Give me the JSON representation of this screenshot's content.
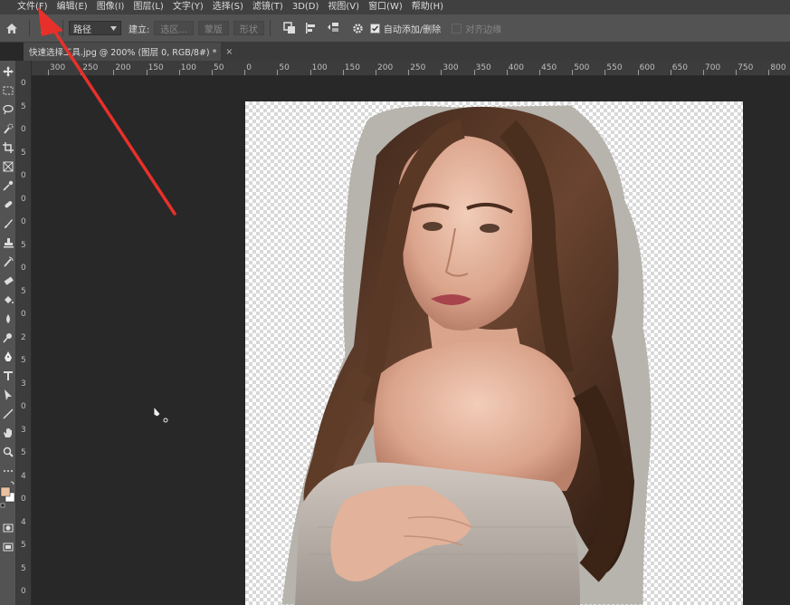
{
  "menu": {
    "items": [
      "文件(F)",
      "编辑(E)",
      "图像(I)",
      "图层(L)",
      "文字(Y)",
      "选择(S)",
      "滤镜(T)",
      "3D(D)",
      "视图(V)",
      "窗口(W)",
      "帮助(H)"
    ]
  },
  "options": {
    "mode_value": "路径",
    "build_label": "建立:",
    "selection_btn": "选区...",
    "mask_btn": "蒙版",
    "shape_btn": "形状",
    "auto_add_delete": "自动添加/删除",
    "align_edges": "对齐边缘"
  },
  "document_tab": {
    "title": "快速选择工具.jpg @ 200% (图层 0, RGB/8#) *",
    "close": "×"
  },
  "ruler": {
    "h_labels": [
      "300",
      "250",
      "200",
      "150",
      "100",
      "50",
      "0",
      "50",
      "100",
      "150",
      "200",
      "250",
      "300",
      "350",
      "400",
      "450",
      "500",
      "550",
      "600",
      "650",
      "700",
      "750",
      "800"
    ],
    "v_labels": [
      "0",
      "5",
      "0",
      "5",
      "0",
      "0",
      "0",
      "5",
      "0",
      "5",
      "0",
      "2",
      "5",
      "3",
      "0",
      "3",
      "5",
      "4",
      "0",
      "4",
      "5",
      "5",
      "0"
    ]
  },
  "colors": {
    "foreground": "#e8c2a0",
    "background": "#ffffff",
    "annotation_arrow": "#e8302a"
  }
}
